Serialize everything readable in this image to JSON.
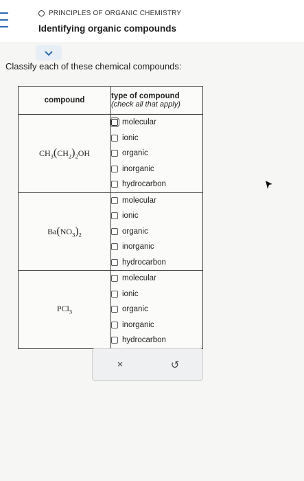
{
  "header": {
    "course": "PRINCIPLES OF ORGANIC CHEMISTRY",
    "title": "Identifying organic compounds"
  },
  "prompt": "Classify each of these chemical compounds:",
  "table": {
    "col1_header": "compound",
    "col2_header": "type of compound",
    "col2_subheader": "(check all that apply)",
    "options": [
      "molecular",
      "ionic",
      "organic",
      "inorganic",
      "hydrocarbon"
    ],
    "rows": [
      {
        "formula": "CH3(CH2)2OH"
      },
      {
        "formula": "Ba(NO3)2"
      },
      {
        "formula": "PCl3"
      }
    ]
  },
  "footer": {
    "clear_symbol": "×",
    "undo_symbol": "↺"
  },
  "icons": [
    "menu-icon",
    "circle-icon",
    "chevron-down-icon",
    "close-icon",
    "undo-icon",
    "cursor-icon"
  ]
}
